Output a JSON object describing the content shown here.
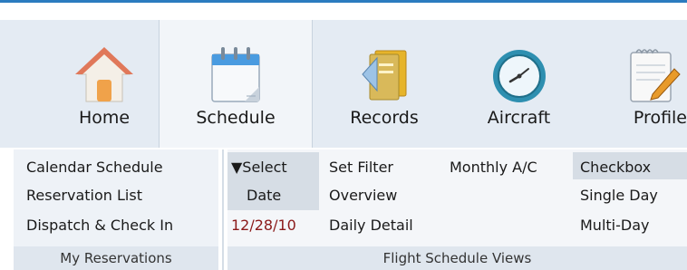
{
  "tabs": [
    {
      "label": "Home",
      "icon": "home-icon"
    },
    {
      "label": "Schedule",
      "icon": "calendar-icon",
      "active": true
    },
    {
      "label": "Records",
      "icon": "records-icon"
    },
    {
      "label": "Aircraft",
      "icon": "aircraft-clock-icon"
    },
    {
      "label": "Profile",
      "icon": "profile-icon"
    }
  ],
  "my_reservations": {
    "items": [
      "Calendar Schedule",
      "Reservation List",
      "Dispatch & Check In"
    ],
    "group_label": "My Reservations"
  },
  "flight_schedule_views": {
    "select_date_line1": "▼Select",
    "select_date_line2": "Date",
    "current_date": "12/28/10",
    "col2": [
      "Set Filter",
      "Overview",
      "Daily Detail"
    ],
    "monthly": "Monthly A/C",
    "col4": [
      "Checkbox",
      "Single Day",
      "Multi-Day"
    ],
    "group_label": "Flight Schedule Views"
  },
  "colors": {
    "accent": "#2b7bbf",
    "date": "#8b1a1a"
  }
}
